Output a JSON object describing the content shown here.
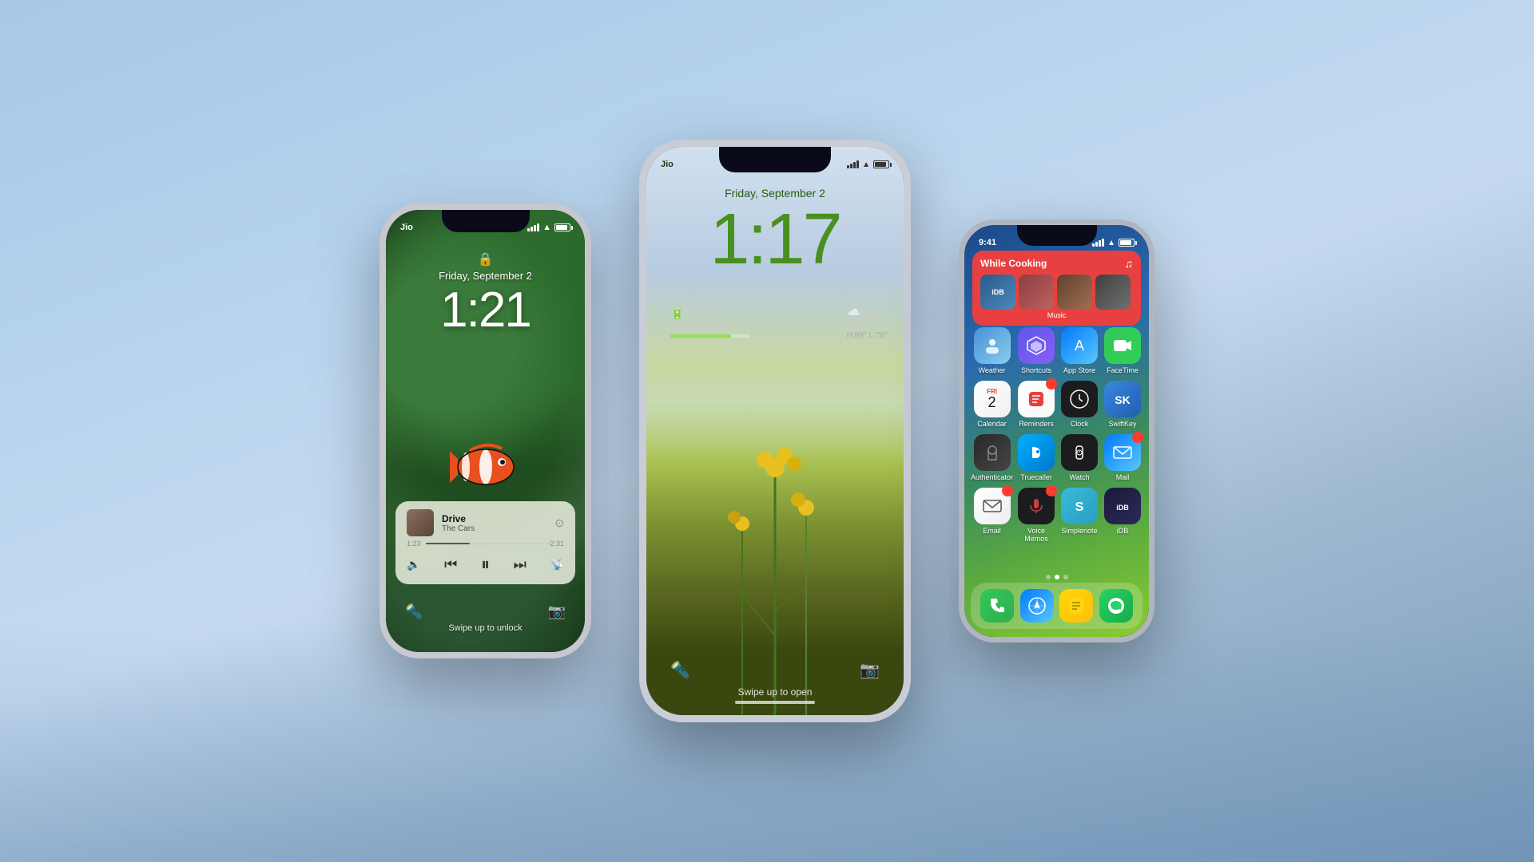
{
  "background": {
    "color": "#a8c8e8"
  },
  "phones": {
    "left": {
      "carrier": "Jio",
      "date": "Friday, September 2",
      "time": "1:21",
      "lock_icon": "🔒",
      "music": {
        "title": "Drive",
        "artist": "The Cars",
        "time_current": "1:23",
        "time_total": "-2:31",
        "progress_pct": 38
      },
      "swipe_text": "Swipe up to unlock"
    },
    "center": {
      "carrier": "Jio",
      "date": "Friday, September 2",
      "time": "1:17",
      "battery_pct": "76%",
      "battery_label": "Ankur's iPhone",
      "weather_temp": "88°",
      "weather_desc": "Cloudy",
      "weather_range": "H:89° L:78°",
      "swipe_text": "Swipe up to open"
    },
    "right": {
      "time": "9:41",
      "music_widget": {
        "title": "While Cooking",
        "label": "Music"
      },
      "apps": [
        {
          "name": "Weather",
          "icon_class": "ic-weather",
          "emoji": "☀️"
        },
        {
          "name": "Shortcuts",
          "icon_class": "ic-shortcuts",
          "emoji": "⬡"
        },
        {
          "name": "App Store",
          "icon_class": "ic-appstore",
          "emoji": "🅐"
        },
        {
          "name": "FaceTime",
          "icon_class": "ic-facetime",
          "emoji": "📹"
        },
        {
          "name": "Calendar",
          "icon_class": "ic-calendar",
          "emoji": ""
        },
        {
          "name": "Reminders",
          "icon_class": "ic-reminders",
          "emoji": "✓",
          "badge": ""
        },
        {
          "name": "Clock",
          "icon_class": "ic-clock",
          "emoji": "🕐"
        },
        {
          "name": "SwiftKey",
          "icon_class": "ic-swiftkey",
          "emoji": "⌨"
        },
        {
          "name": "Authenticator",
          "icon_class": "ic-authenticator",
          "emoji": "🔐"
        },
        {
          "name": "Truecaller",
          "icon_class": "ic-truecaller",
          "emoji": "📞"
        },
        {
          "name": "Watch",
          "icon_class": "ic-watch",
          "emoji": "⌚"
        },
        {
          "name": "Mail",
          "icon_class": "ic-mail",
          "emoji": "✉️",
          "badge": ""
        },
        {
          "name": "Email",
          "icon_class": "ic-email",
          "emoji": "📧",
          "badge": ""
        },
        {
          "name": "Voice Memos",
          "icon_class": "ic-voicememos",
          "emoji": "🎙",
          "badge": ""
        },
        {
          "name": "Simplenote",
          "icon_class": "ic-simplenote",
          "emoji": "S"
        },
        {
          "name": "iDB",
          "icon_class": "ic-idb",
          "emoji": "iDB"
        }
      ],
      "dock": [
        {
          "name": "Phone",
          "icon_class": "ic-phone",
          "emoji": "📱"
        },
        {
          "name": "Safari",
          "icon_class": "ic-safari",
          "emoji": "🧭"
        },
        {
          "name": "Notes",
          "icon_class": "ic-notes",
          "emoji": "📝"
        },
        {
          "name": "WhatsApp",
          "icon_class": "ic-whatsapp",
          "emoji": "💬"
        }
      ]
    }
  }
}
